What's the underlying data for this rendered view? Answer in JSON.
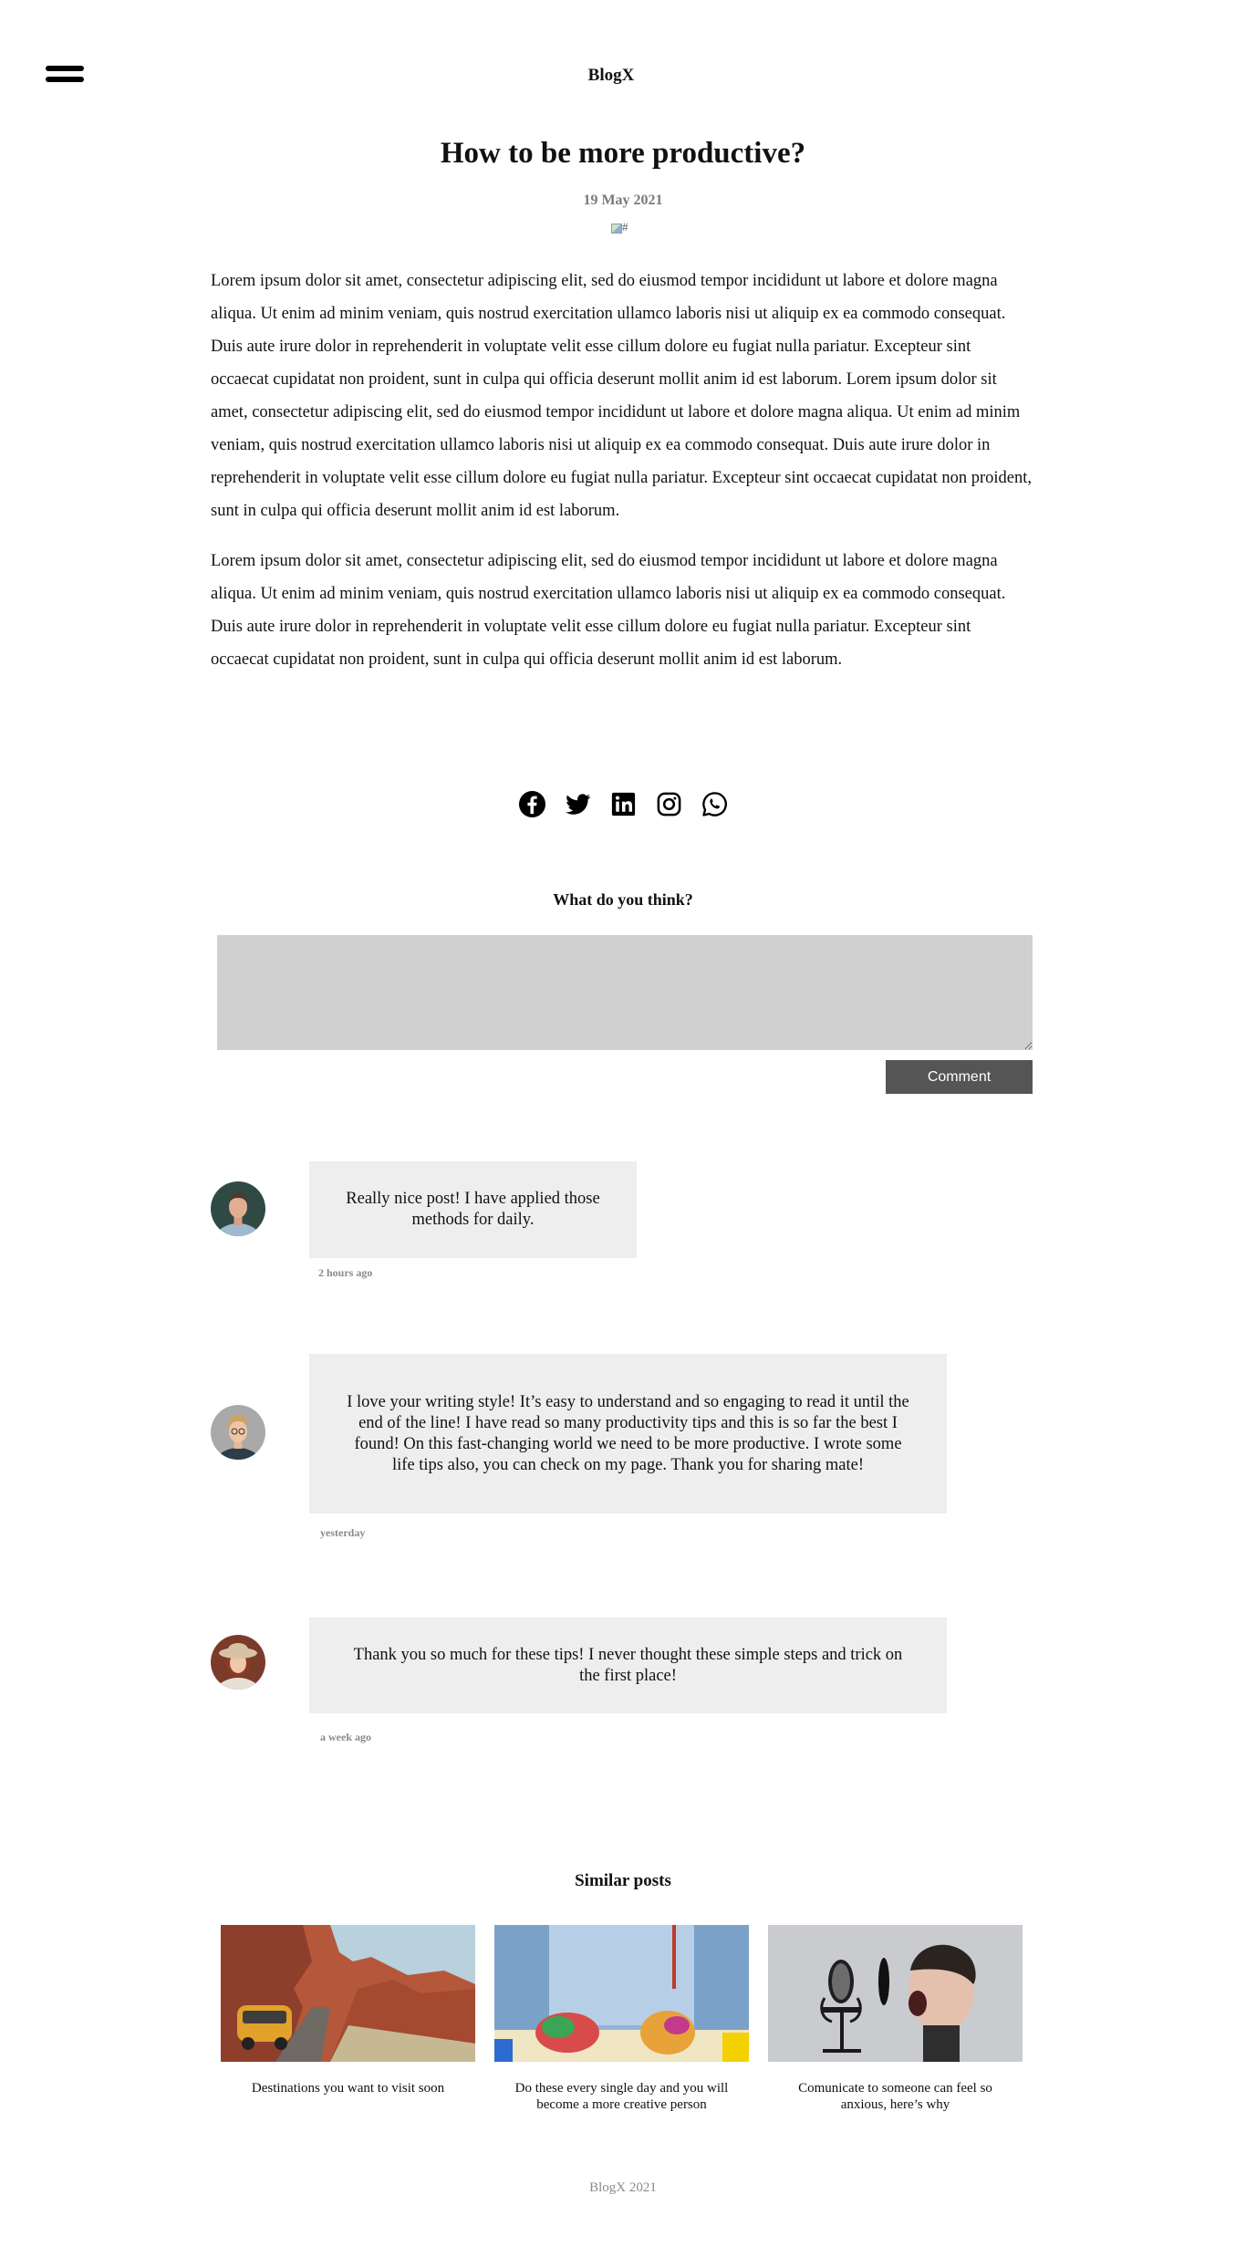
{
  "header": {
    "menu_icon": "hamburger-menu-icon",
    "brand": "BlogX"
  },
  "post": {
    "title": "How to be more productive?",
    "date": "19 May 2021",
    "image_alt": "#",
    "paragraphs": [
      "Lorem ipsum dolor sit amet, consectetur adipiscing elit, sed do eiusmod tempor incididunt ut labore et dolore magna aliqua. Ut enim ad minim veniam, quis nostrud exercitation ullamco laboris nisi ut aliquip ex ea commodo consequat. Duis aute irure dolor in reprehenderit in voluptate velit esse cillum dolore eu fugiat nulla pariatur. Excepteur sint occaecat cupidatat non proident, sunt in culpa qui officia deserunt mollit anim id est laborum. Lorem ipsum dolor sit amet, consectetur adipiscing elit, sed do eiusmod tempor incididunt ut labore et dolore magna aliqua. Ut enim ad minim veniam, quis nostrud exercitation ullamco laboris nisi ut aliquip ex ea commodo consequat. Duis aute irure dolor in reprehenderit in voluptate velit esse cillum dolore eu fugiat nulla pariatur. Excepteur sint occaecat cupidatat non proident, sunt in culpa qui officia deserunt mollit anim id est laborum.",
      "Lorem ipsum dolor sit amet, consectetur adipiscing elit, sed do eiusmod tempor incididunt ut labore et dolore magna aliqua. Ut enim ad minim veniam, quis nostrud exercitation ullamco laboris nisi ut aliquip ex ea commodo consequat. Duis aute irure dolor in reprehenderit in voluptate velit esse cillum dolore eu fugiat nulla pariatur. Excepteur sint occaecat cupidatat non proident, sunt in culpa qui officia deserunt mollit anim id est laborum."
    ]
  },
  "share": {
    "icons": [
      "facebook-icon",
      "twitter-icon",
      "linkedin-icon",
      "instagram-icon",
      "whatsapp-icon"
    ]
  },
  "comment_form": {
    "heading": "What do you think?",
    "textarea_value": "",
    "button_label": "Comment"
  },
  "comments": [
    {
      "text": "Really nice post! I have applied those methods for daily.",
      "time": "2 hours ago"
    },
    {
      "text": "I love your writing style! It’s easy to understand and so engaging to read it until the end of the line! I have read so many productivity tips and this is so far the best I found! On this fast-changing world we need to be more productive. I wrote some life tips also, you can check on my page. Thank you for sharing mate!",
      "time": "yesterday"
    },
    {
      "text": "Thank you so much for these tips! I never thought these simple steps and trick on the first place!",
      "time": "a week ago"
    }
  ],
  "similar": {
    "heading": "Similar posts",
    "posts": [
      {
        "title": "Destinations you want to visit soon"
      },
      {
        "title": "Do these every single day and you will become a more creative person"
      },
      {
        "title": "Comunicate to someone can feel so anxious, here’s why"
      }
    ]
  },
  "footer": {
    "text": "BlogX 2021"
  }
}
